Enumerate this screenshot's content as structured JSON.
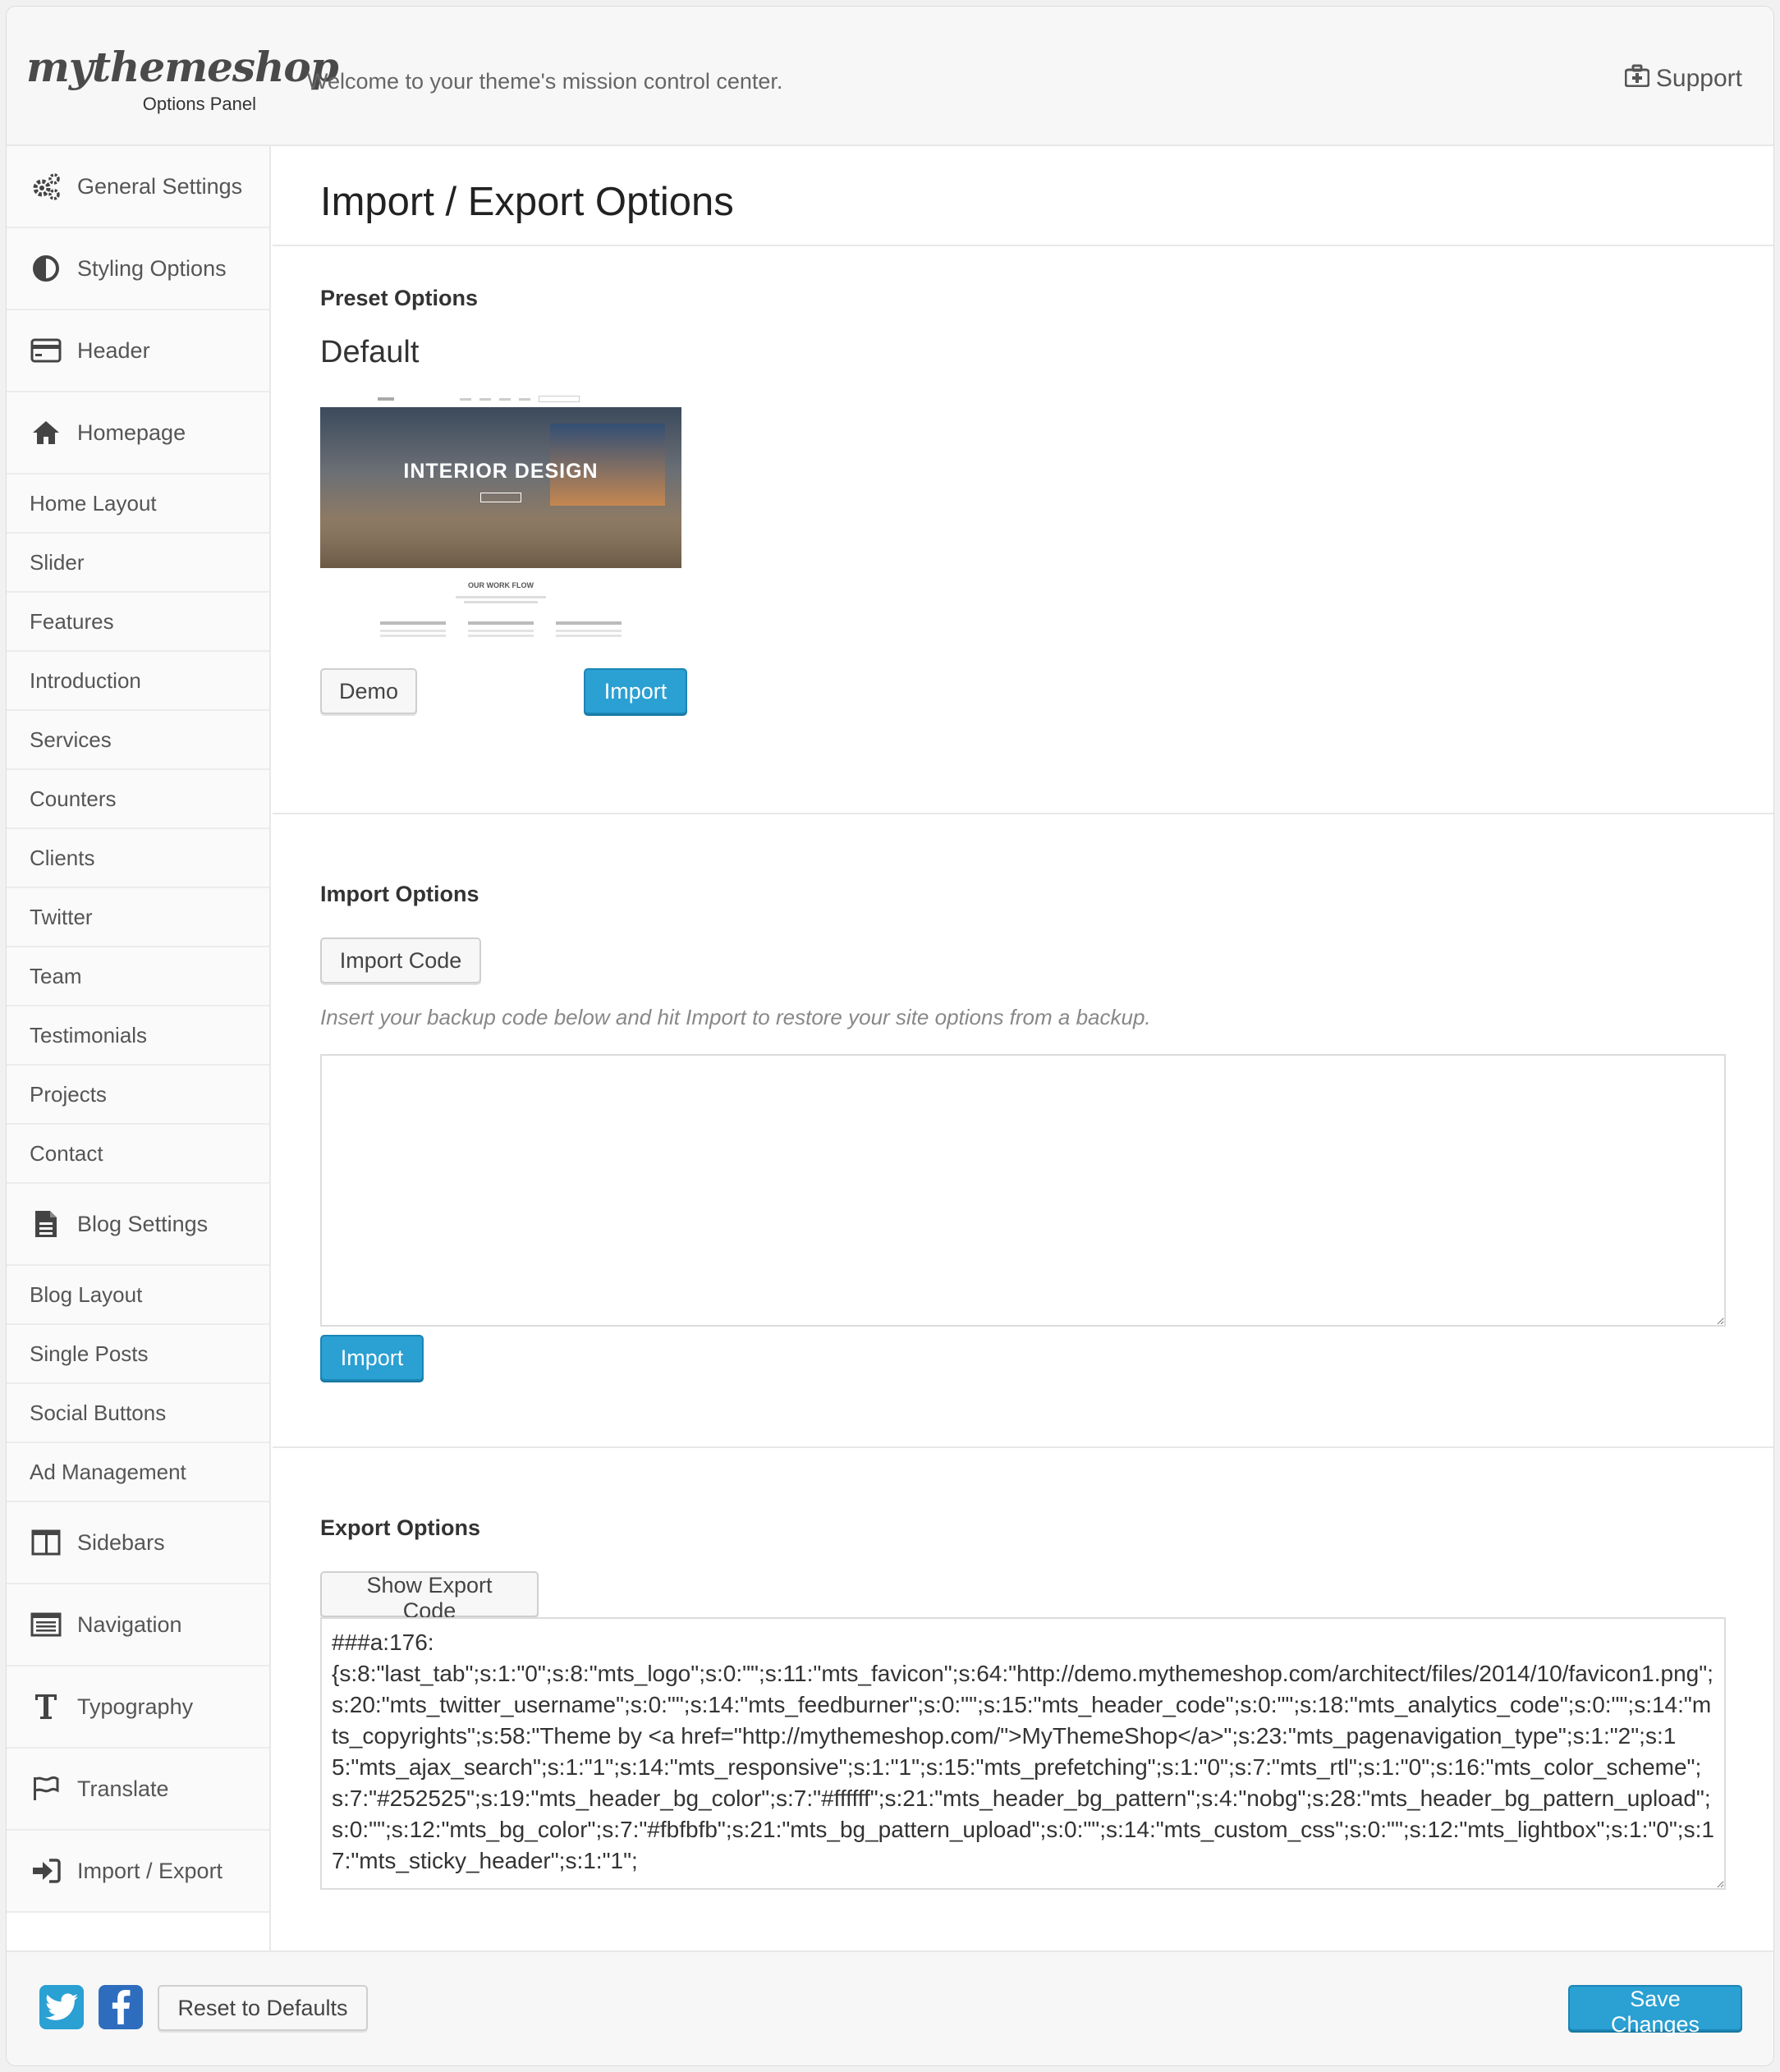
{
  "brand": {
    "logo": "mythemeshop",
    "subtitle": "Options Panel"
  },
  "header": {
    "welcome": "Welcome to your theme's mission control center.",
    "support": "Support"
  },
  "sidebar": {
    "items": [
      {
        "label": "General Settings",
        "type": "main",
        "icon": "gears-icon"
      },
      {
        "label": "Styling Options",
        "type": "main",
        "icon": "contrast-icon"
      },
      {
        "label": "Header",
        "type": "main",
        "icon": "credit-card-icon"
      },
      {
        "label": "Homepage",
        "type": "main",
        "icon": "home-icon"
      },
      {
        "label": "Home Layout",
        "type": "sub"
      },
      {
        "label": "Slider",
        "type": "sub"
      },
      {
        "label": "Features",
        "type": "sub"
      },
      {
        "label": "Introduction",
        "type": "sub"
      },
      {
        "label": "Services",
        "type": "sub"
      },
      {
        "label": "Counters",
        "type": "sub"
      },
      {
        "label": "Clients",
        "type": "sub"
      },
      {
        "label": "Twitter",
        "type": "sub"
      },
      {
        "label": "Team",
        "type": "sub"
      },
      {
        "label": "Testimonials",
        "type": "sub"
      },
      {
        "label": "Projects",
        "type": "sub"
      },
      {
        "label": "Contact",
        "type": "sub"
      },
      {
        "label": "Blog Settings",
        "type": "main",
        "icon": "document-icon"
      },
      {
        "label": "Blog Layout",
        "type": "sub"
      },
      {
        "label": "Single Posts",
        "type": "sub"
      },
      {
        "label": "Social Buttons",
        "type": "sub"
      },
      {
        "label": "Ad Management",
        "type": "sub"
      },
      {
        "label": "Sidebars",
        "type": "main",
        "icon": "columns-icon"
      },
      {
        "label": "Navigation",
        "type": "main",
        "icon": "list-icon"
      },
      {
        "label": "Typography",
        "type": "main",
        "icon": "text-icon"
      },
      {
        "label": "Translate",
        "type": "main",
        "icon": "flag-icon"
      },
      {
        "label": "Import / Export",
        "type": "main",
        "icon": "sign-in-icon"
      }
    ]
  },
  "main": {
    "title": "Import / Export Options",
    "preset": {
      "section_title": "Preset Options",
      "preset_name": "Default",
      "thumbnail_text": "INTERIOR DESIGN",
      "thumbnail_subtext": "OUR WORK FLOW",
      "demo_label": "Demo",
      "import_label": "Import"
    },
    "import": {
      "section_title": "Import Options",
      "code_button": "Import Code",
      "hint": "Insert your backup code below and hit Import to restore your site options from a backup.",
      "textarea_value": "",
      "import_label": "Import"
    },
    "export": {
      "section_title": "Export Options",
      "show_button": "Show Export Code",
      "code": "###a:176:\n{s:8:\"last_tab\";s:1:\"0\";s:8:\"mts_logo\";s:0:\"\";s:11:\"mts_favicon\";s:64:\"http://demo.mythemeshop.com/architect/files/2014/10/favicon1.png\";s:20:\"mts_twitter_username\";s:0:\"\";s:14:\"mts_feedburner\";s:0:\"\";s:15:\"mts_header_code\";s:0:\"\";s:18:\"mts_analytics_code\";s:0:\"\";s:14:\"mts_copyrights\";s:58:\"Theme by <a href=\"http://mythemeshop.com/\">MyThemeShop</a>\";s:23:\"mts_pagenavigation_type\";s:1:\"2\";s:15:\"mts_ajax_search\";s:1:\"1\";s:14:\"mts_responsive\";s:1:\"1\";s:15:\"mts_prefetching\";s:1:\"0\";s:7:\"mts_rtl\";s:1:\"0\";s:16:\"mts_color_scheme\";s:7:\"#252525\";s:19:\"mts_header_bg_color\";s:7:\"#ffffff\";s:21:\"mts_header_bg_pattern\";s:4:\"nobg\";s:28:\"mts_header_bg_pattern_upload\";s:0:\"\";s:12:\"mts_bg_color\";s:7:\"#fbfbfb\";s:21:\"mts_bg_pattern_upload\";s:0:\"\";s:14:\"mts_custom_css\";s:0:\"\";s:12:\"mts_lightbox\";s:1:\"0\";s:17:\"mts_sticky_header\";s:1:\"1\";"
    }
  },
  "footer": {
    "reset_label": "Reset to Defaults",
    "save_label": "Save Changes"
  },
  "colors": {
    "accent": "#2aa0d3",
    "twitter": "#2aa0d3",
    "facebook": "#2e6dbd"
  }
}
